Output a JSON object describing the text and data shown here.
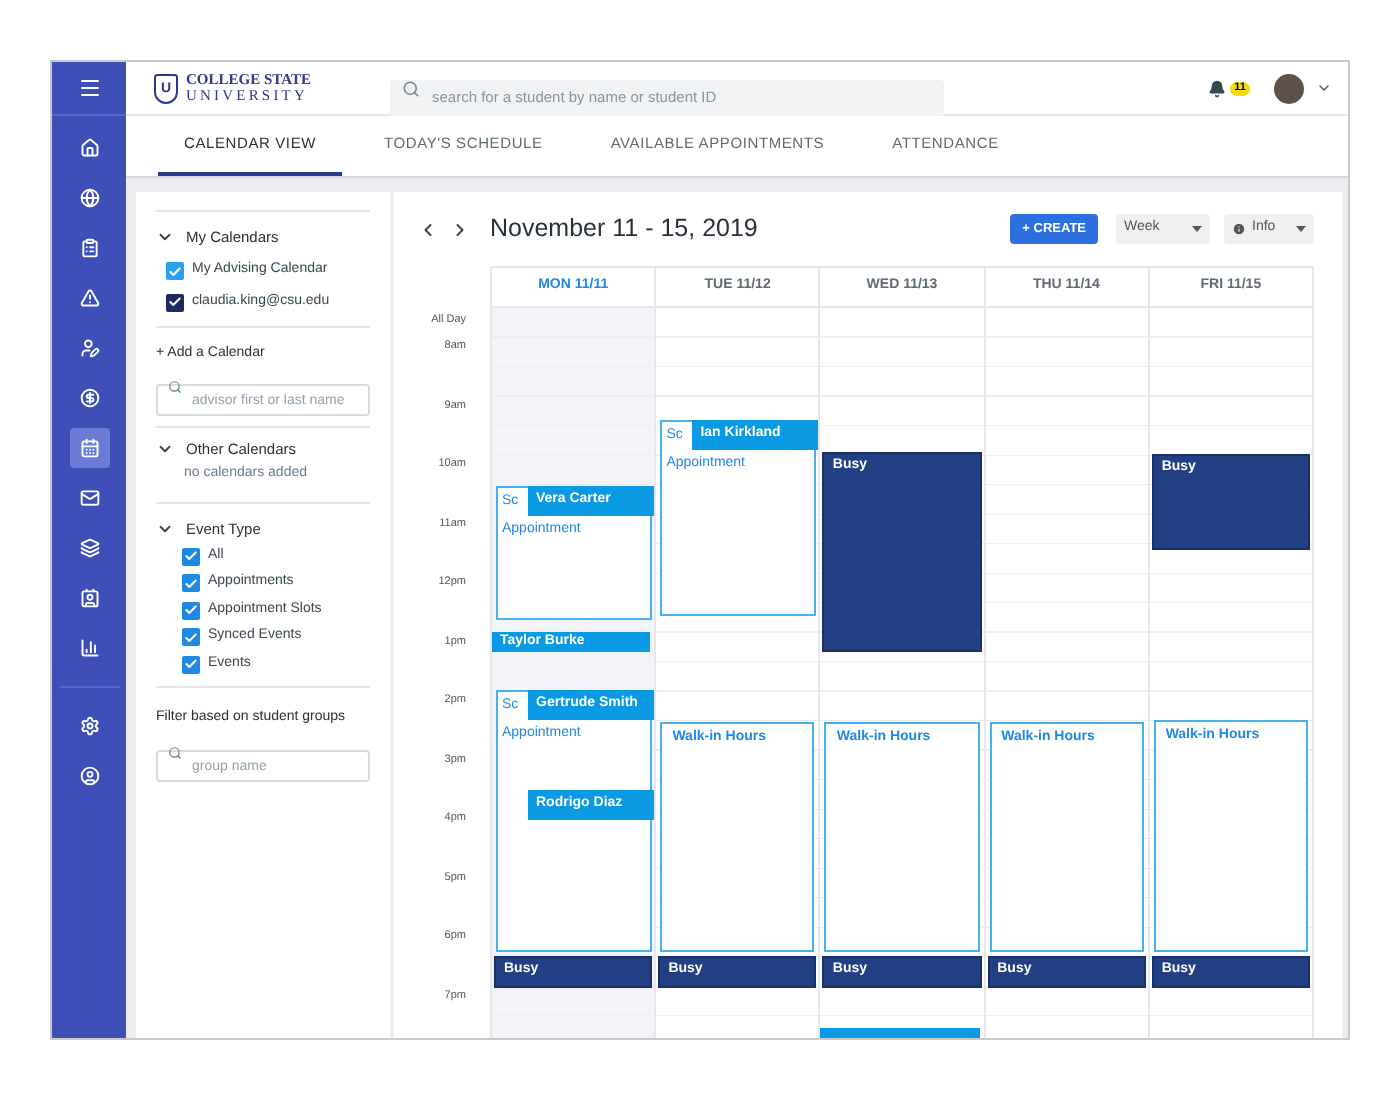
{
  "logo": {
    "mark": "U",
    "line_1": "COLLEGE STATE",
    "line_2": "UNIVERSITY"
  },
  "search": {
    "placeholder": "search for a student by name or student ID"
  },
  "notifications": {
    "count": "11"
  },
  "sidebar": {
    "items": [
      {
        "selected": false
      },
      {
        "selected": false
      },
      {
        "selected": false
      },
      {
        "selected": false
      },
      {
        "selected": false
      },
      {
        "selected": false
      },
      {
        "selected": true
      },
      {
        "selected": false
      },
      {
        "selected": false
      },
      {
        "selected": false
      },
      {
        "selected": false
      },
      {
        "selected": false
      },
      {
        "selected": false
      }
    ]
  },
  "tabs": [
    {
      "label": "CALENDAR VIEW",
      "selected": true
    },
    {
      "label": "TODAY'S SCHEDULE",
      "selected": false
    },
    {
      "label": "AVAILABLE APPOINTMENTS",
      "selected": false
    },
    {
      "label": "ATTENDANCE",
      "selected": false
    }
  ],
  "my_calendars": {
    "title": "My Calendars",
    "expanded": true,
    "items": [
      {
        "label": "My Advising Calendar",
        "checked": true,
        "color": "#29a0f0"
      },
      {
        "label": "claudia.king@csu.edu",
        "checked": true,
        "color": "#1c2a64"
      }
    ]
  },
  "add_calendar": {
    "title": "+ Add a Calendar",
    "placeholder": "advisor first or last name"
  },
  "other_calendars": {
    "title": "Other Calendars",
    "expanded": true,
    "empty_text": "no calendars added"
  },
  "event_type": {
    "title": "Event Type",
    "expanded": true,
    "items": [
      {
        "label": "All",
        "checked": true
      },
      {
        "label": "Appointments",
        "checked": true
      },
      {
        "label": "Appointment Slots",
        "checked": true
      },
      {
        "label": "Synced Events",
        "checked": true
      },
      {
        "label": "Events",
        "checked": true
      }
    ]
  },
  "group_filter": {
    "title": "Filter based on student groups",
    "placeholder": "group name"
  },
  "calendar": {
    "title": "November 11 - 15, 2019",
    "create_button": "+ CREATE",
    "view_select": "Week",
    "info_select": "Info",
    "time_labels": [
      "All Day",
      "8am",
      "9am",
      "10am",
      "11am",
      "12pm",
      "1pm",
      "2pm",
      "3pm",
      "4pm",
      "5pm",
      "6pm",
      "7pm"
    ],
    "days": [
      {
        "label": "MON 11/11",
        "selected": true,
        "events": [
          {
            "kind": "slot",
            "label": "Sc",
            "sublabel": "Appointment",
            "names": [
              "Vera Carter"
            ]
          },
          {
            "kind": "appointment",
            "title": "Taylor Burke"
          },
          {
            "kind": "slot",
            "label": "Sc",
            "sublabel": "Appointment",
            "names": [
              "Gertrude Smith",
              "Rodrigo Diaz"
            ]
          },
          {
            "kind": "busy",
            "title": "Busy"
          }
        ]
      },
      {
        "label": "TUE 11/12",
        "selected": false,
        "events": [
          {
            "kind": "slot",
            "label": "Sc",
            "sublabel": "Appointment",
            "names": [
              "Ian Kirkland"
            ]
          },
          {
            "kind": "walkin",
            "title": "Walk-in Hours"
          },
          {
            "kind": "busy",
            "title": "Busy"
          }
        ]
      },
      {
        "label": "WED 11/13",
        "selected": false,
        "events": [
          {
            "kind": "busy",
            "title": "Busy"
          },
          {
            "kind": "walkin",
            "title": "Walk-in Hours"
          },
          {
            "kind": "busy",
            "title": "Busy"
          },
          {
            "kind": "appointment"
          }
        ]
      },
      {
        "label": "THU 11/14",
        "selected": false,
        "events": [
          {
            "kind": "walkin",
            "title": "Walk-in Hours"
          },
          {
            "kind": "busy",
            "title": "Busy"
          }
        ]
      },
      {
        "label": "FRI 11/15",
        "selected": false,
        "events": [
          {
            "kind": "busy",
            "title": "Busy"
          },
          {
            "kind": "walkin",
            "title": "Walk-in Hours"
          },
          {
            "kind": "busy",
            "title": "Busy"
          }
        ]
      }
    ]
  }
}
